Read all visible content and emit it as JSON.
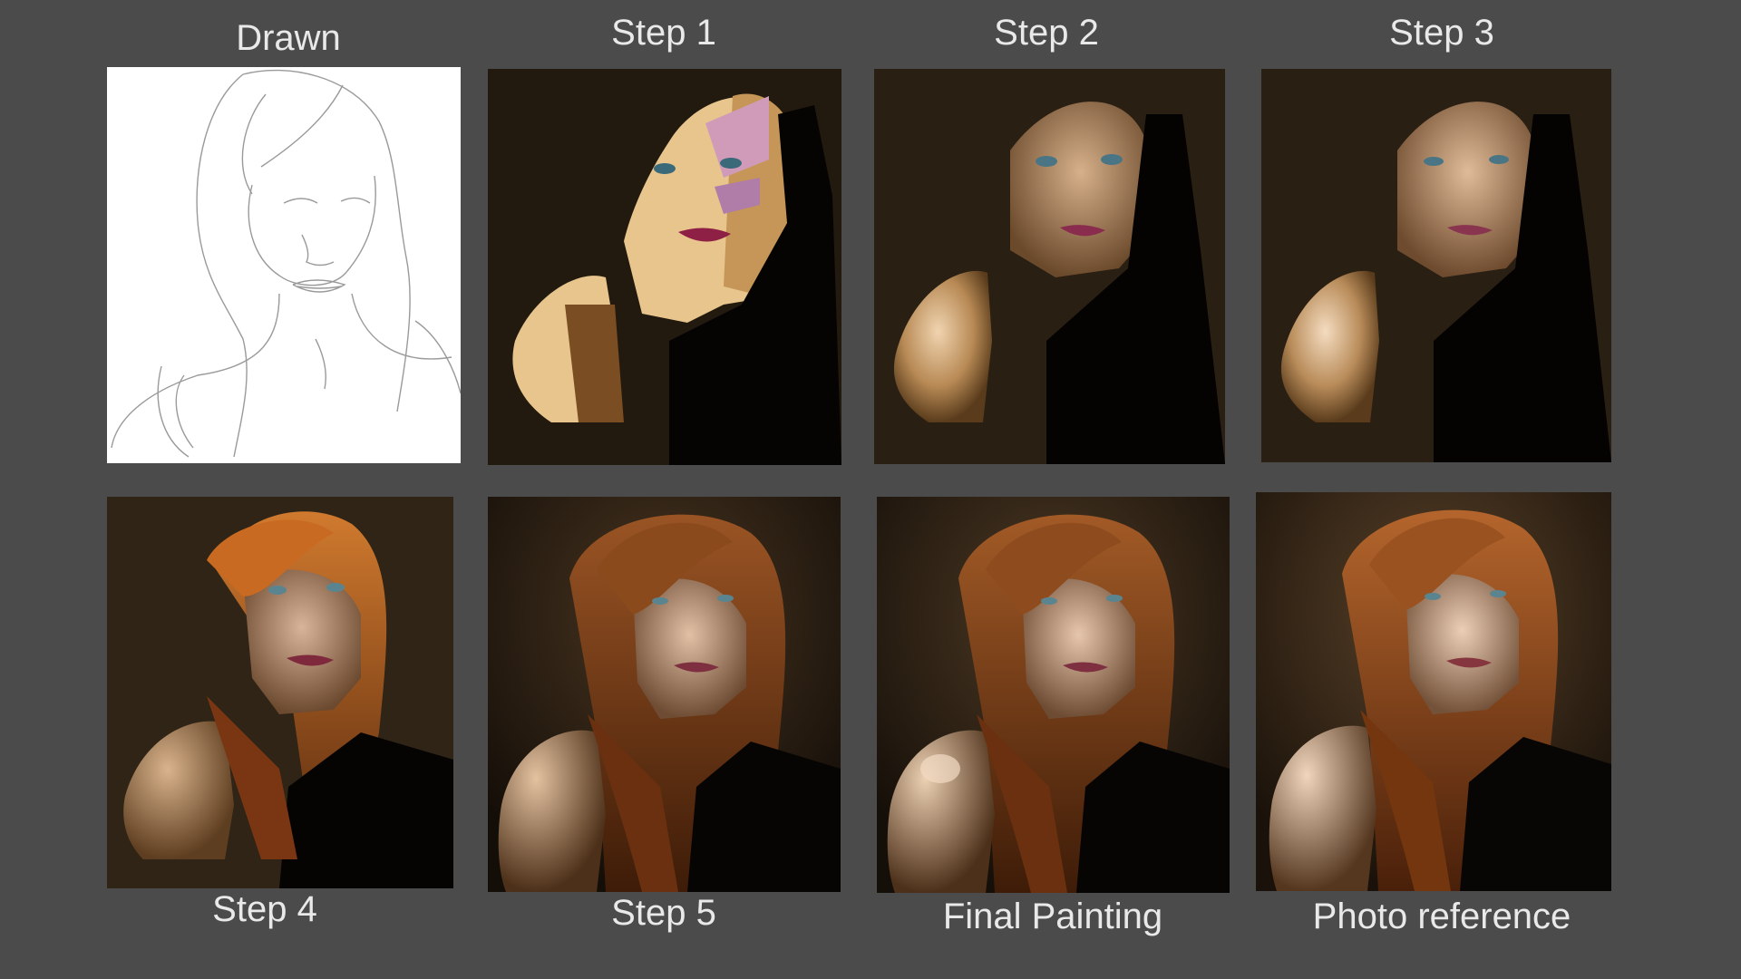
{
  "captions": {
    "drawn": "Drawn",
    "step1": "Step 1",
    "step2": "Step 2",
    "step3": "Step 3",
    "step4": "Step 4",
    "step5": "Step 5",
    "final": "Final Painting",
    "reference": "Photo reference"
  },
  "colors": {
    "background": "#4b4b4b",
    "caption_text": "#e9e9e9",
    "sketch_paper": "#ffffff",
    "painting_backdrop": "#2a1f13",
    "skin_light": "#e7c58c",
    "skin_mid": "#c69658",
    "skin_shadow": "#7a4d22",
    "hair": "#8a4a1c",
    "lips": "#8e1f45"
  },
  "panels": [
    {
      "id": "drawn",
      "stage": "sketch"
    },
    {
      "id": "step1",
      "stage": "flat colors"
    },
    {
      "id": "step2",
      "stage": "blended shadows"
    },
    {
      "id": "step3",
      "stage": "refined skin"
    },
    {
      "id": "step4",
      "stage": "hair added"
    },
    {
      "id": "step5",
      "stage": "rendered"
    },
    {
      "id": "final",
      "stage": "final"
    },
    {
      "id": "reference",
      "stage": "photo"
    }
  ]
}
